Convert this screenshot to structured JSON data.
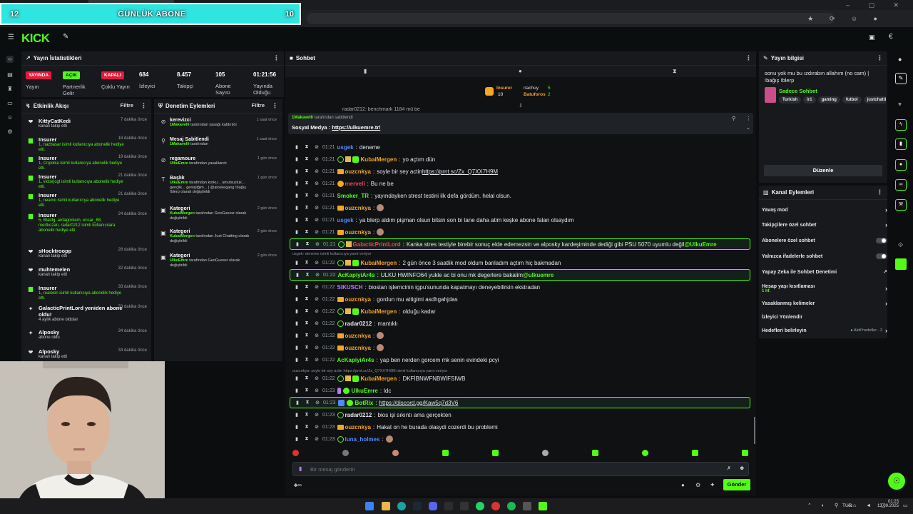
{
  "banner": {
    "left": "12",
    "title": "GÜNLÜK ABONE",
    "right": "10"
  },
  "logo": "KICK",
  "stats": {
    "title": "Yayın İstatistikleri",
    "items": [
      {
        "badge": "YAYINDA",
        "badge_color": "#e01b3c",
        "label": "Yayın"
      },
      {
        "badge": "AÇIK",
        "badge_color": "#53fc18",
        "label": "Partnerlik Gelir"
      },
      {
        "badge": "KAPALI",
        "badge_color": "#e01b3c",
        "label": "Çoklu Yayın"
      },
      {
        "value": "684",
        "label": "İzleyici"
      },
      {
        "value": "8.457",
        "label": "Takipçi"
      },
      {
        "value": "105",
        "label": "Abone Sayısı"
      },
      {
        "value": "01:21:56",
        "label": "Yayında Olduğu"
      }
    ]
  },
  "activity": {
    "title": "Etkinlik Akışı",
    "filter": "Filtre",
    "items": [
      {
        "name": "KittyCatKedi",
        "desc": "kanalı takip etti",
        "time": "7 dakika önce",
        "icon": "heart",
        "green": false
      },
      {
        "name": "Insurer",
        "desc": "1, nazbasar isimli kullanıcıya abonelik hediye etti.",
        "time": "18 dakika önce",
        "icon": "gift",
        "green": true
      },
      {
        "name": "Insurer",
        "desc": "1, Cnpolka isimli kullanıcıya abonelik hediye etti.",
        "time": "19 dakika önce",
        "icon": "gift",
        "green": true
      },
      {
        "name": "Insurer",
        "desc": "1, victorjcgt isimli kullanıcıya abonelik hediye etti.",
        "time": "21 dakika önce",
        "icon": "gift",
        "green": true
      },
      {
        "name": "Insurer",
        "desc": "1, neamo isimli kullanıcıya abonelik hediye etti.",
        "time": "21 dakika önce",
        "icon": "gift",
        "green": true
      },
      {
        "name": "Insurer",
        "desc": "5, Blaidg, ardagorkem, ensar_68, mertkozan, radar0212 isimli kullanıcılara abonelik hediye etti.",
        "time": "24 dakika önce",
        "icon": "gift",
        "green": true
      },
      {
        "name": "sHocktroopp",
        "desc": "kanalı takip etti",
        "time": "28 dakika önce",
        "icon": "heart",
        "green": false
      },
      {
        "name": "muhtemelen",
        "desc": "kanalı takip etti",
        "time": "32 dakika önce",
        "icon": "heart",
        "green": false
      },
      {
        "name": "Insurer",
        "desc": "1, realekin isimli kullanıcıya abonelik hediye etti.",
        "time": "33 dakika önce",
        "icon": "gift",
        "green": true
      },
      {
        "name": "GalacticPrintLord yeniden abone oldu!",
        "desc": "4 aylık abone oldular",
        "time": "33 dakika önce",
        "icon": "star",
        "green": false
      },
      {
        "name": "Alposky",
        "desc": "abone oldu",
        "time": "34 dakika önce",
        "icon": "star",
        "green": false
      },
      {
        "name": "Alposky",
        "desc": "kanalı takip etti",
        "time": "34 dakika önce",
        "icon": "heart",
        "green": false
      }
    ]
  },
  "mod": {
    "title": "Denetim Eylemleri",
    "filter": "Filtre",
    "items": [
      {
        "name": "kerevizci",
        "actor": "1Makavelli",
        "desc": "tarafından yasağı kaldırıldı",
        "time": "1 saat önce",
        "icon": "ban"
      },
      {
        "name": "Mesaj Sabitlendi",
        "actor": "1Makavelli",
        "desc": "tarafından",
        "time": "1 saat önce",
        "icon": "pin"
      },
      {
        "name": "regamoure",
        "actor": "UlkuEmre",
        "desc": "tarafından yasaklandı",
        "time": "1 gün önce",
        "icon": "ban"
      },
      {
        "name": "Başlık",
        "actor": "UlkuEmre",
        "desc": "tarafından korku... umutsuzluk... gençlik... genişliğim... | @aloskegang !bağış !blerp olarak değiştirildi",
        "time": "1 gün önce",
        "icon": "text"
      },
      {
        "name": "Kategori",
        "actor": "KubaiMergen",
        "desc": "tarafından GeoGuessr olarak değiştirildi",
        "time": "2 gün önce",
        "icon": "cat"
      },
      {
        "name": "Kategori",
        "actor": "KubaiMergen",
        "desc": "tarafından Just Chatting olarak değiştirildi",
        "time": "2 gün önce",
        "icon": "cat"
      },
      {
        "name": "Kategori",
        "actor": "UlkuEmre",
        "desc": "tarafından GeoGuessr olarak değiştirildi",
        "time": "2 gün önce",
        "icon": "cat"
      }
    ]
  },
  "chat": {
    "title": "Sohbet",
    "leaderboard": [
      {
        "name": "Insurer",
        "value": "10"
      },
      {
        "name": "nachuy",
        "value": "5"
      },
      {
        "name": "Batuforos",
        "value": "2"
      }
    ],
    "peek": "radar0212: benchmark 1184 mü be",
    "pinned": {
      "by": "1Makavelli",
      "suffix": "tarafından sabitlendi",
      "text": "Sosyal Medya : ",
      "link": "https://ulkuemre.tr/"
    },
    "reply_notes": [
      {
        "text": "usgek: deneme isimli kullanıcıya yanıt veriyor"
      },
      {
        "text": "ouzcnkya: soyle bir sey actin https://prnt.sc/Zx_Q7XX7H9M isimli kullanıcıya yanıt veriyor"
      }
    ],
    "messages": [
      {
        "time": "01:21",
        "user": "usgek",
        "color": "#4d8bff",
        "text": "deneme",
        "badges": ""
      },
      {
        "time": "01:21",
        "user": "KubaiMergen",
        "color": "#f5a623",
        "text": "yo açtım dün",
        "badges": "sub,gift,mod"
      },
      {
        "time": "01:21",
        "user": "ouzcnkya",
        "color": "#f5a623",
        "text": "soyle bir sey actin ",
        "link": "https://prnt.sc/Zx_Q7XX7H9M",
        "badges": "crown"
      },
      {
        "time": "01:21",
        "user": "merveli",
        "color": "#e84a4a",
        "text": "Bu ne be",
        "badges": "coin"
      },
      {
        "time": "01:21",
        "user": "Smoker_TR",
        "color": "#53fc18",
        "text": "yayındayken strest testini ilk defa gördüm. helal olsun.",
        "badges": ""
      },
      {
        "time": "01:21",
        "user": "ouzcnkya",
        "color": "#f5a623",
        "text": "",
        "emote": true,
        "badges": "crown"
      },
      {
        "time": "01:21",
        "user": "usgek",
        "color": "#4d8bff",
        "text": "ya blerp aldım pişman olsun bitsin son bi tane daha atim keşke abone falan olsaydım",
        "badges": ""
      },
      {
        "time": "01:21",
        "user": "ouzcnkya",
        "color": "#f5a623",
        "text": "",
        "emote": true,
        "badges": "crown"
      },
      {
        "time": "01:21",
        "user": "GalacticPrintLord",
        "color": "#e84a4a",
        "text": "Kanka stres testiyle birebir sonuç elde edemezsin ve alposky kardeşiminde dediği gibi PSU 5070 uyumlu değil ",
        "mention": "@UlkuEmre",
        "badges": "sub,gift",
        "highlight": true
      },
      {
        "time": "01:22",
        "user": "KubaiMergen",
        "color": "#f5a623",
        "text": "2 gün önce 3 saatlik mod oldum banladım açtım hiç bakmadan",
        "badges": "sub,gift,mod"
      },
      {
        "time": "01:22",
        "user": "AcKapiyiAr4s",
        "color": "#53fc18",
        "text": "ULKU HWINFO64 yukle ac bi onu mk degerlere bakalim ",
        "mention": "@ulkuemre",
        "badges": "",
        "highlight": true
      },
      {
        "time": "01:22",
        "user": "SIKUSCH",
        "color": "#b77bff",
        "text": "biostan işlemcinin igpu'sununda kapatmayı deneyebilirsin ekstradan",
        "badges": ""
      },
      {
        "time": "01:22",
        "user": "ouzcnkya",
        "color": "#f5a623",
        "text": "gordun mu attigimi asdhgahjdas",
        "badges": "crown"
      },
      {
        "time": "01:22",
        "user": "KubaiMergen",
        "color": "#f5a623",
        "text": "olduğu kadar",
        "badges": "sub,gift,mod"
      },
      {
        "time": "01:22",
        "user": "radar0212",
        "color": "#e5e7eb",
        "text": "mantıklı",
        "badges": "sub"
      },
      {
        "time": "01:22",
        "user": "ouzcnkya",
        "color": "#f5a623",
        "text": "",
        "emote": true,
        "badges": "crown"
      },
      {
        "time": "01:22",
        "user": "ouzcnkya",
        "color": "#f5a623",
        "text": "",
        "emote": true,
        "badges": "crown"
      },
      {
        "time": "01:22",
        "user": "AcKapiyiAr4s",
        "color": "#53fc18",
        "text": "yap ben nerden gorcem mk senin evindeki pcyi",
        "badges": ""
      },
      {
        "time": "01:22",
        "user": "KubaiMergen",
        "color": "#f5a623",
        "text": "DKFİBNWFNBWİFSIWB",
        "badges": "sub,gift,mod"
      },
      {
        "time": "01:23",
        "user": "UlkuEmre",
        "color": "#53fc18",
        "text": "ldc",
        "badges": "mic,verified"
      },
      {
        "time": "01:23",
        "user": "BotRix",
        "color": "#53fc18",
        "text": "",
        "link": "https://discord.gg/Kaw5q7d3V6",
        "badges": "bot,verified",
        "highlight": true
      },
      {
        "time": "01:23",
        "user": "radar0212",
        "color": "#e5e7eb",
        "text": "bios işi sıkıntı ama gerçekten",
        "badges": "sub"
      },
      {
        "time": "01:23",
        "user": "ouzcnkya",
        "color": "#f5a623",
        "text": "Hakat on he burada olasydi cozerdi bu problemi",
        "badges": "crown"
      },
      {
        "time": "01:23",
        "user": "luna_holmes",
        "color": "#4d8bff",
        "text": "",
        "emote": true,
        "badges": "sub"
      }
    ],
    "input_placeholder": "Bir mesaj gönderin",
    "send_label": "Gönder"
  },
  "info": {
    "title": "Yayın bilgisi",
    "stream_title": "sonu yok mu bu ızdırabın allahım (no cam) | !bağış !blerp",
    "category": "Sadece Sohbet",
    "tags": [
      "Turkish",
      "ir1",
      "gaming",
      "futbol",
      "justchattin"
    ],
    "edit_label": "Düzenle"
  },
  "channel": {
    "title": "Kanal Eylemleri",
    "items": [
      {
        "label": "Yavaş mod",
        "type": "arrow"
      },
      {
        "label": "Takipçilere özel sohbet",
        "type": "arrow"
      },
      {
        "label": "Abonelere özel sohbet",
        "type": "toggle"
      },
      {
        "label": "Yalnızca ifadelerle sohbet",
        "type": "toggle"
      },
      {
        "label": "Yapay Zeka ile Sohbet Denetimi",
        "type": "ext"
      },
      {
        "label": "Hesap yaşı kısıtlaması",
        "sub": "1 hf.",
        "type": "arrow"
      },
      {
        "label": "Yasaklanmış kelimeler",
        "type": "arrow"
      },
      {
        "label": "İzleyici Yönlendir",
        "type": "none"
      },
      {
        "label": "Hedefleri belirleyin",
        "status": "Aktif hedefler - 2",
        "type": "arrow"
      }
    ]
  },
  "taskbar": {
    "lang": "TUR",
    "time": "01:23",
    "date": "13.09.2025"
  }
}
